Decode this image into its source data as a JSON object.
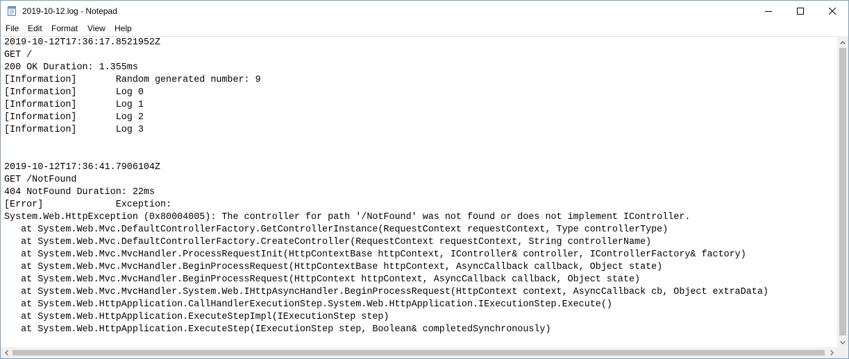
{
  "window": {
    "title": "2019-10-12.log - Notepad"
  },
  "menu": [
    "File",
    "Edit",
    "Format",
    "View",
    "Help"
  ],
  "editor": {
    "content": "2019-10-12T17:36:17.8521952Z\nGET /\n200 OK Duration: 1.355ms\n[Information]       Random generated number: 9\n[Information]       Log 0\n[Information]       Log 1\n[Information]       Log 2\n[Information]       Log 3\n\n\n2019-10-12T17:36:41.7906104Z\nGET /NotFound\n404 NotFound Duration: 22ms\n[Error]             Exception:\nSystem.Web.HttpException (0x80004005): The controller for path '/NotFound' was not found or does not implement IController.\n   at System.Web.Mvc.DefaultControllerFactory.GetControllerInstance(RequestContext requestContext, Type controllerType)\n   at System.Web.Mvc.DefaultControllerFactory.CreateController(RequestContext requestContext, String controllerName)\n   at System.Web.Mvc.MvcHandler.ProcessRequestInit(HttpContextBase httpContext, IController& controller, IControllerFactory& factory)\n   at System.Web.Mvc.MvcHandler.BeginProcessRequest(HttpContextBase httpContext, AsyncCallback callback, Object state)\n   at System.Web.Mvc.MvcHandler.BeginProcessRequest(HttpContext httpContext, AsyncCallback callback, Object state)\n   at System.Web.Mvc.MvcHandler.System.Web.IHttpAsyncHandler.BeginProcessRequest(HttpContext context, AsyncCallback cb, Object extraData)\n   at System.Web.HttpApplication.CallHandlerExecutionStep.System.Web.HttpApplication.IExecutionStep.Execute()\n   at System.Web.HttpApplication.ExecuteStepImpl(IExecutionStep step)\n   at System.Web.HttpApplication.ExecuteStep(IExecutionStep step, Boolean& completedSynchronously)"
  },
  "icons": {
    "app": "notepad-icon",
    "minimize": "minimize-icon",
    "maximize": "maximize-icon",
    "close": "close-icon"
  }
}
